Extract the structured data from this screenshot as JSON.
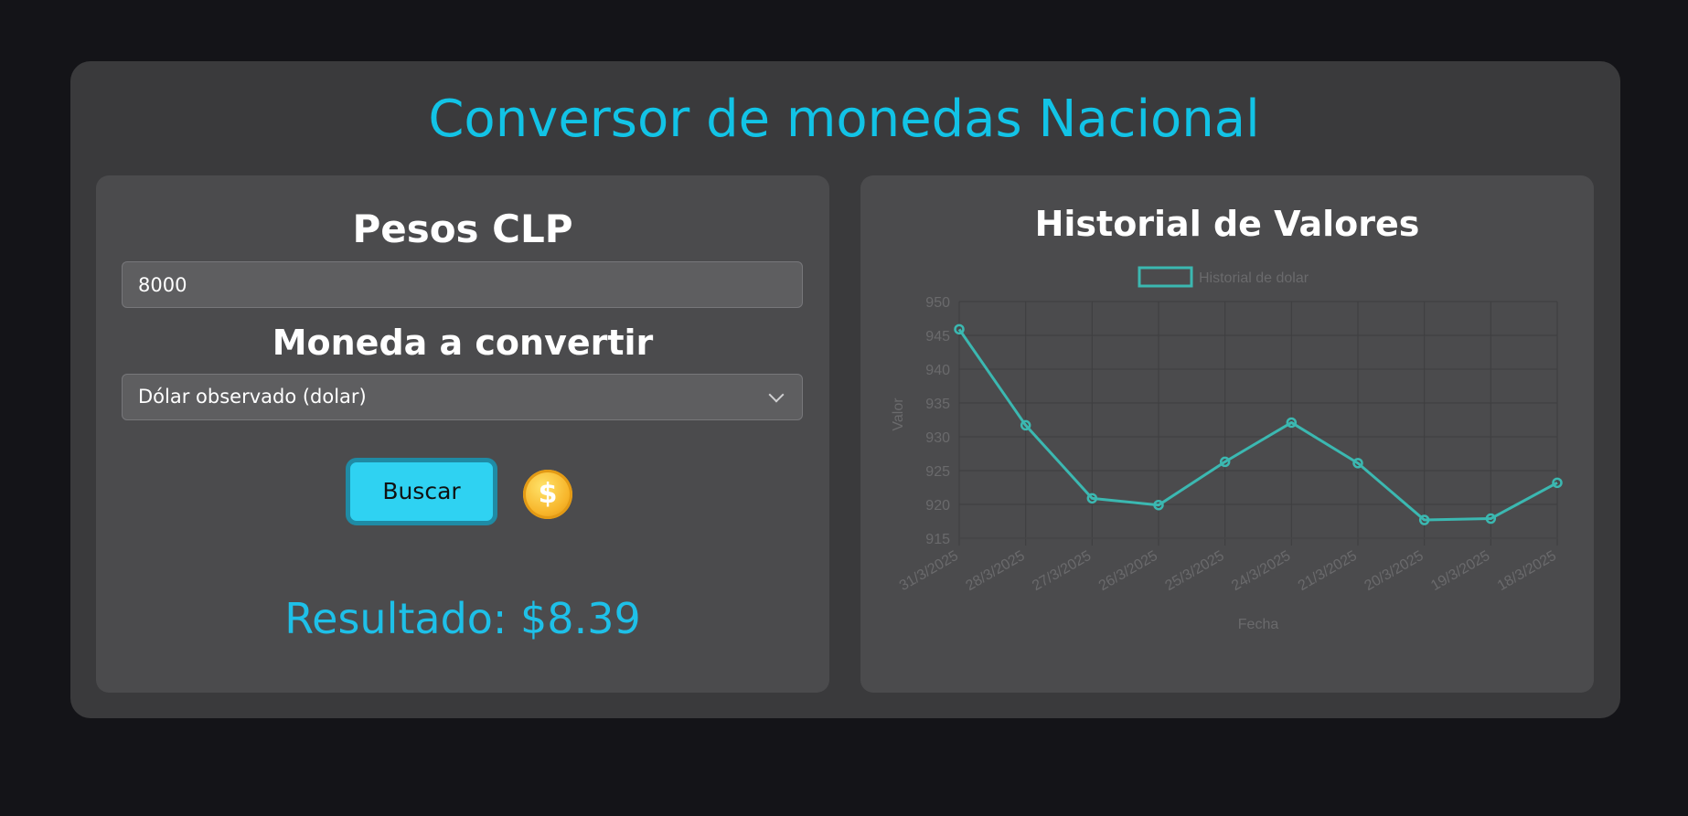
{
  "app": {
    "title": "Conversor de monedas Nacional"
  },
  "converter": {
    "amount_heading": "Pesos CLP",
    "amount_value": "8000",
    "currency_heading": "Moneda a convertir",
    "currency_selected": "Dólar observado (dolar)",
    "search_label": "Buscar",
    "coin_symbol": "$",
    "result_text": "Resultado: $8.39"
  },
  "history": {
    "heading": "Historial de Valores"
  },
  "colors": {
    "accent": "#12c3e6",
    "button": "#2fd2f2",
    "line": "#3bb8b1",
    "page_bg": "#141418",
    "card_bg": "#3a3a3c",
    "panel_bg": "#4b4b4d"
  },
  "chart_data": {
    "type": "line",
    "legend": "Historial de dolar",
    "legend_position": "top",
    "xlabel": "Fecha",
    "ylabel": "Valor",
    "grid": true,
    "ylim": [
      915,
      950
    ],
    "yticks": [
      950,
      945,
      940,
      935,
      930,
      925,
      920,
      915
    ],
    "categories": [
      "31/3/2025",
      "28/3/2025",
      "27/3/2025",
      "26/3/2025",
      "25/3/2025",
      "24/3/2025",
      "21/3/2025",
      "20/3/2025",
      "19/3/2025",
      "18/3/2025"
    ],
    "series": [
      {
        "name": "Historial de dolar",
        "values": [
          945.9,
          931.7,
          920.9,
          919.9,
          926.3,
          932.1,
          926.1,
          917.7,
          917.9,
          923.2
        ]
      }
    ]
  }
}
